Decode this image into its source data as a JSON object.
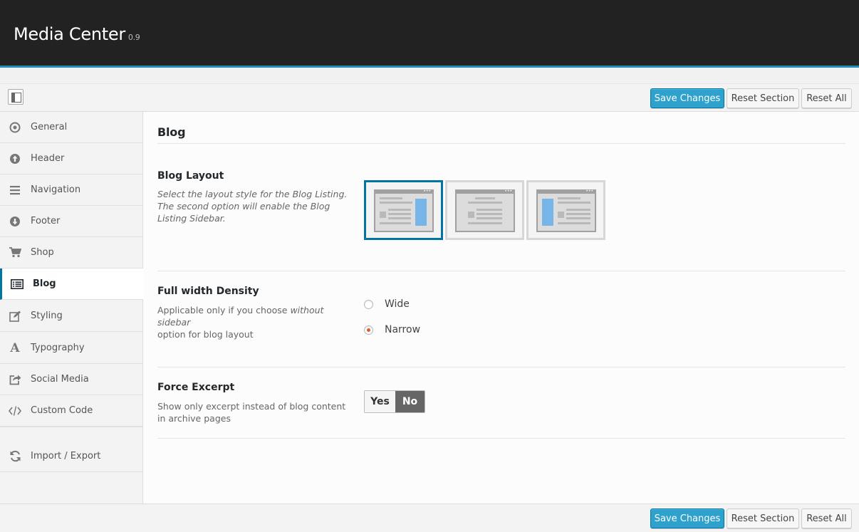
{
  "app": {
    "title": "Media Center",
    "version": "0.9"
  },
  "toolbar": {
    "save_label": "Save Changes",
    "reset_section_label": "Reset Section",
    "reset_all_label": "Reset All"
  },
  "sidebar": {
    "items": [
      {
        "label": "General",
        "icon": "target-icon"
      },
      {
        "label": "Header",
        "icon": "arrow-up-circle-icon"
      },
      {
        "label": "Navigation",
        "icon": "menu-lines-icon"
      },
      {
        "label": "Footer",
        "icon": "arrow-down-circle-icon"
      },
      {
        "label": "Shop",
        "icon": "cart-icon"
      },
      {
        "label": "Blog",
        "icon": "list-icon",
        "active": true
      },
      {
        "label": "Styling",
        "icon": "edit-icon"
      },
      {
        "label": "Typography",
        "icon": "font-icon"
      },
      {
        "label": "Social Media",
        "icon": "share-icon"
      },
      {
        "label": "Custom Code",
        "icon": "code-icon"
      },
      {
        "label": "Import / Export",
        "icon": "refresh-icon"
      }
    ]
  },
  "main": {
    "section_title": "Blog",
    "blog_layout": {
      "title": "Blog Layout",
      "desc_line1": "Select the layout style for the Blog Listing.",
      "desc_line2": "The second option will enable the Blog Listing Sidebar.",
      "selected_index": 0
    },
    "density": {
      "title": "Full width Density",
      "desc_prefix": "Applicable only if you choose ",
      "desc_em": "without sidebar",
      "desc_suffix": "option for blog layout",
      "options": [
        "Wide",
        "Narrow"
      ],
      "selected": "Narrow"
    },
    "excerpt": {
      "title": "Force Excerpt",
      "desc": "Show only excerpt instead of blog content in archive pages",
      "yes_label": "Yes",
      "no_label": "No",
      "value": "No"
    }
  },
  "colors": {
    "accent": "#2ea2cc",
    "active_border": "#0074a2",
    "radio_checked": "#dd5c2c",
    "header_bg": "#222222"
  }
}
